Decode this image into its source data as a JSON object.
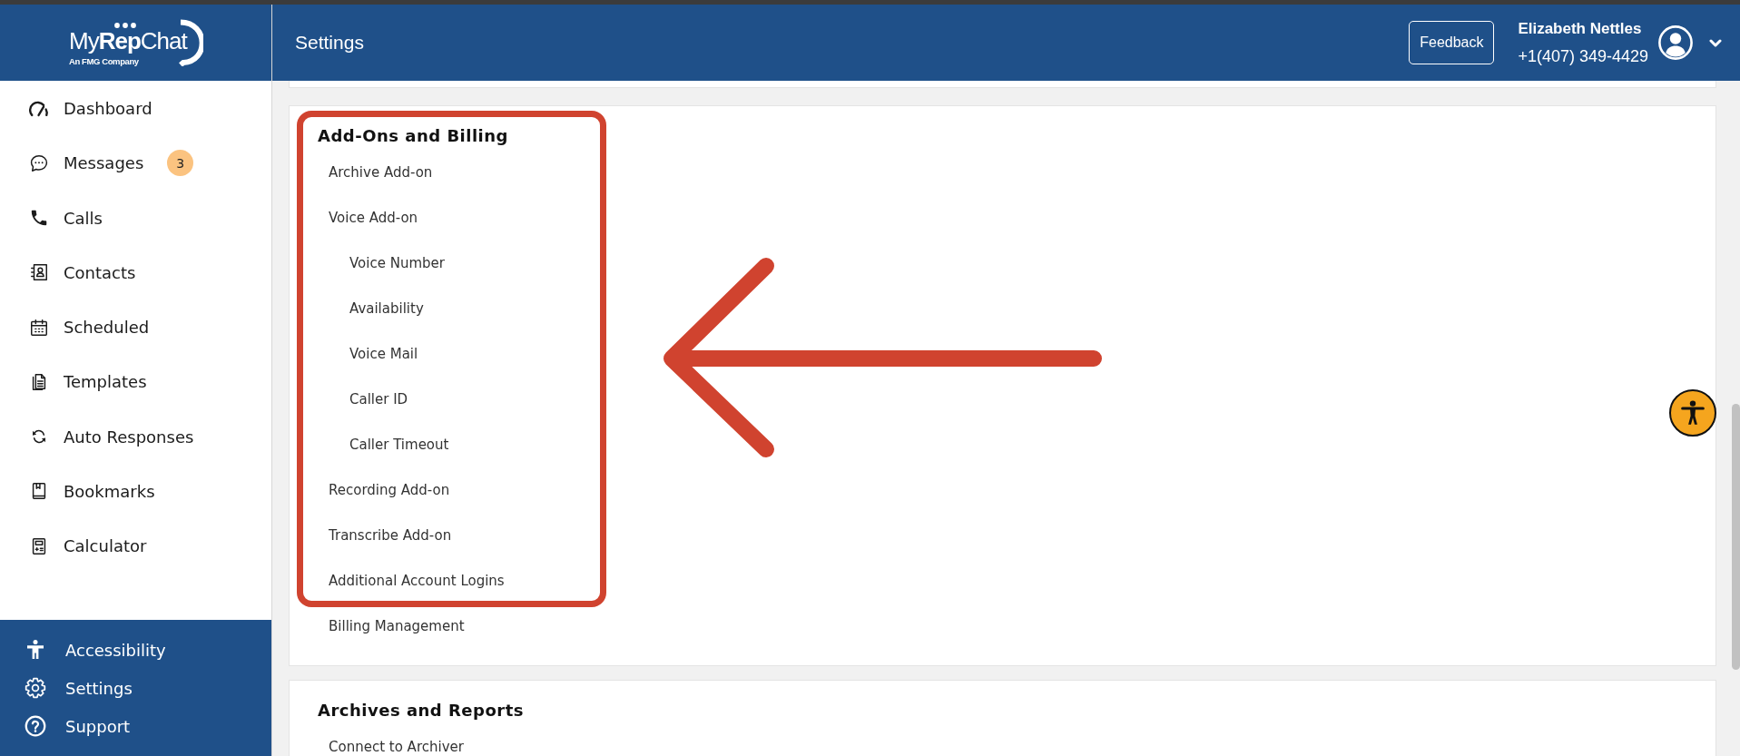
{
  "logo": {
    "name": "My**Rep**Chat",
    "tagline": "An FMG Company"
  },
  "sidebar": {
    "items": [
      {
        "label": "Dashboard"
      },
      {
        "label": "Messages",
        "badge": "3"
      },
      {
        "label": "Calls"
      },
      {
        "label": "Contacts"
      },
      {
        "label": "Scheduled"
      },
      {
        "label": "Templates"
      },
      {
        "label": "Auto Responses"
      },
      {
        "label": "Bookmarks"
      },
      {
        "label": "Calculator"
      }
    ],
    "footer_items": [
      {
        "label": "Accessibility"
      },
      {
        "label": "Settings"
      },
      {
        "label": "Support"
      }
    ]
  },
  "header": {
    "title": "Settings",
    "feedback_button": "Feedback",
    "user": {
      "name": "Elizabeth Nettles",
      "phone": "+1(407) 349-4429"
    }
  },
  "sections": [
    {
      "title": "Add-Ons and Billing",
      "items": [
        {
          "label": "Archive Add-on"
        },
        {
          "label": "Voice Add-on",
          "children": [
            {
              "label": "Voice Number"
            },
            {
              "label": "Availability"
            },
            {
              "label": "Voice Mail"
            },
            {
              "label": "Caller ID"
            },
            {
              "label": "Caller Timeout"
            }
          ]
        },
        {
          "label": "Recording Add-on"
        },
        {
          "label": "Transcribe Add-on"
        },
        {
          "label": "Additional Account Logins"
        },
        {
          "label": "Billing Management"
        }
      ],
      "annotations": {
        "frame": true,
        "arrow": true
      }
    },
    {
      "title": "Archives and Reports",
      "items": [
        {
          "label": "Connect to Archiver"
        }
      ]
    }
  ]
}
